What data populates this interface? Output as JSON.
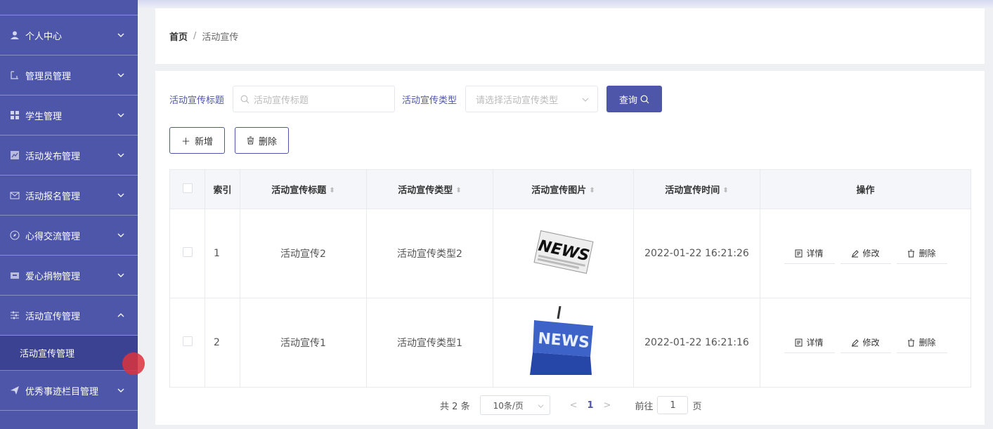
{
  "sidebar": {
    "items": [
      {
        "label": "个人中心",
        "icon": "user-icon",
        "expanded": false
      },
      {
        "label": "管理员管理",
        "icon": "admin-icon",
        "expanded": false
      },
      {
        "label": "学生管理",
        "icon": "grid-icon",
        "expanded": false
      },
      {
        "label": "活动发布管理",
        "icon": "chart-icon",
        "expanded": false
      },
      {
        "label": "活动报名管理",
        "icon": "mail-icon",
        "expanded": false
      },
      {
        "label": "心得交流管理",
        "icon": "compass-icon",
        "expanded": false
      },
      {
        "label": "爱心捐物管理",
        "icon": "box-icon",
        "expanded": false
      },
      {
        "label": "活动宣传管理",
        "icon": "sliders-icon",
        "expanded": true
      },
      {
        "label": "优秀事迹栏目管理",
        "icon": "send-icon",
        "expanded": false
      }
    ],
    "subitem": "活动宣传管理"
  },
  "breadcrumb": {
    "home": "首页",
    "separator": "/",
    "current": "活动宣传"
  },
  "filters": {
    "title_label": "活动宣传标题",
    "title_placeholder": "活动宣传标题",
    "type_label": "活动宣传类型",
    "type_placeholder": "请选择活动宣传类型",
    "query_button": "查询"
  },
  "actions": {
    "add": "新增",
    "delete": "删除"
  },
  "table": {
    "headers": {
      "index": "索引",
      "title": "活动宣传标题",
      "type": "活动宣传类型",
      "image": "活动宣传图片",
      "time": "活动宣传时间",
      "ops": "操作"
    },
    "rows": [
      {
        "index": "1",
        "title": "活动宣传2",
        "type": "活动宣传类型2",
        "time": "2022-01-22 16:21:26"
      },
      {
        "index": "2",
        "title": "活动宣传1",
        "type": "活动宣传类型1",
        "time": "2022-01-22 16:21:16"
      }
    ],
    "row_ops": {
      "detail": "详情",
      "edit": "修改",
      "delete": "删除"
    }
  },
  "pager": {
    "total_prefix": "共",
    "total": "2",
    "total_suffix": "条",
    "page_size": "10条/页",
    "current": "1",
    "goto_prefix": "前往",
    "goto_value": "1",
    "goto_suffix": "页"
  },
  "images": {
    "news1": "NEWS",
    "news2": "NEWS"
  },
  "colors": {
    "primary": "#4e56a9",
    "sidebar": "#4e56a9"
  }
}
